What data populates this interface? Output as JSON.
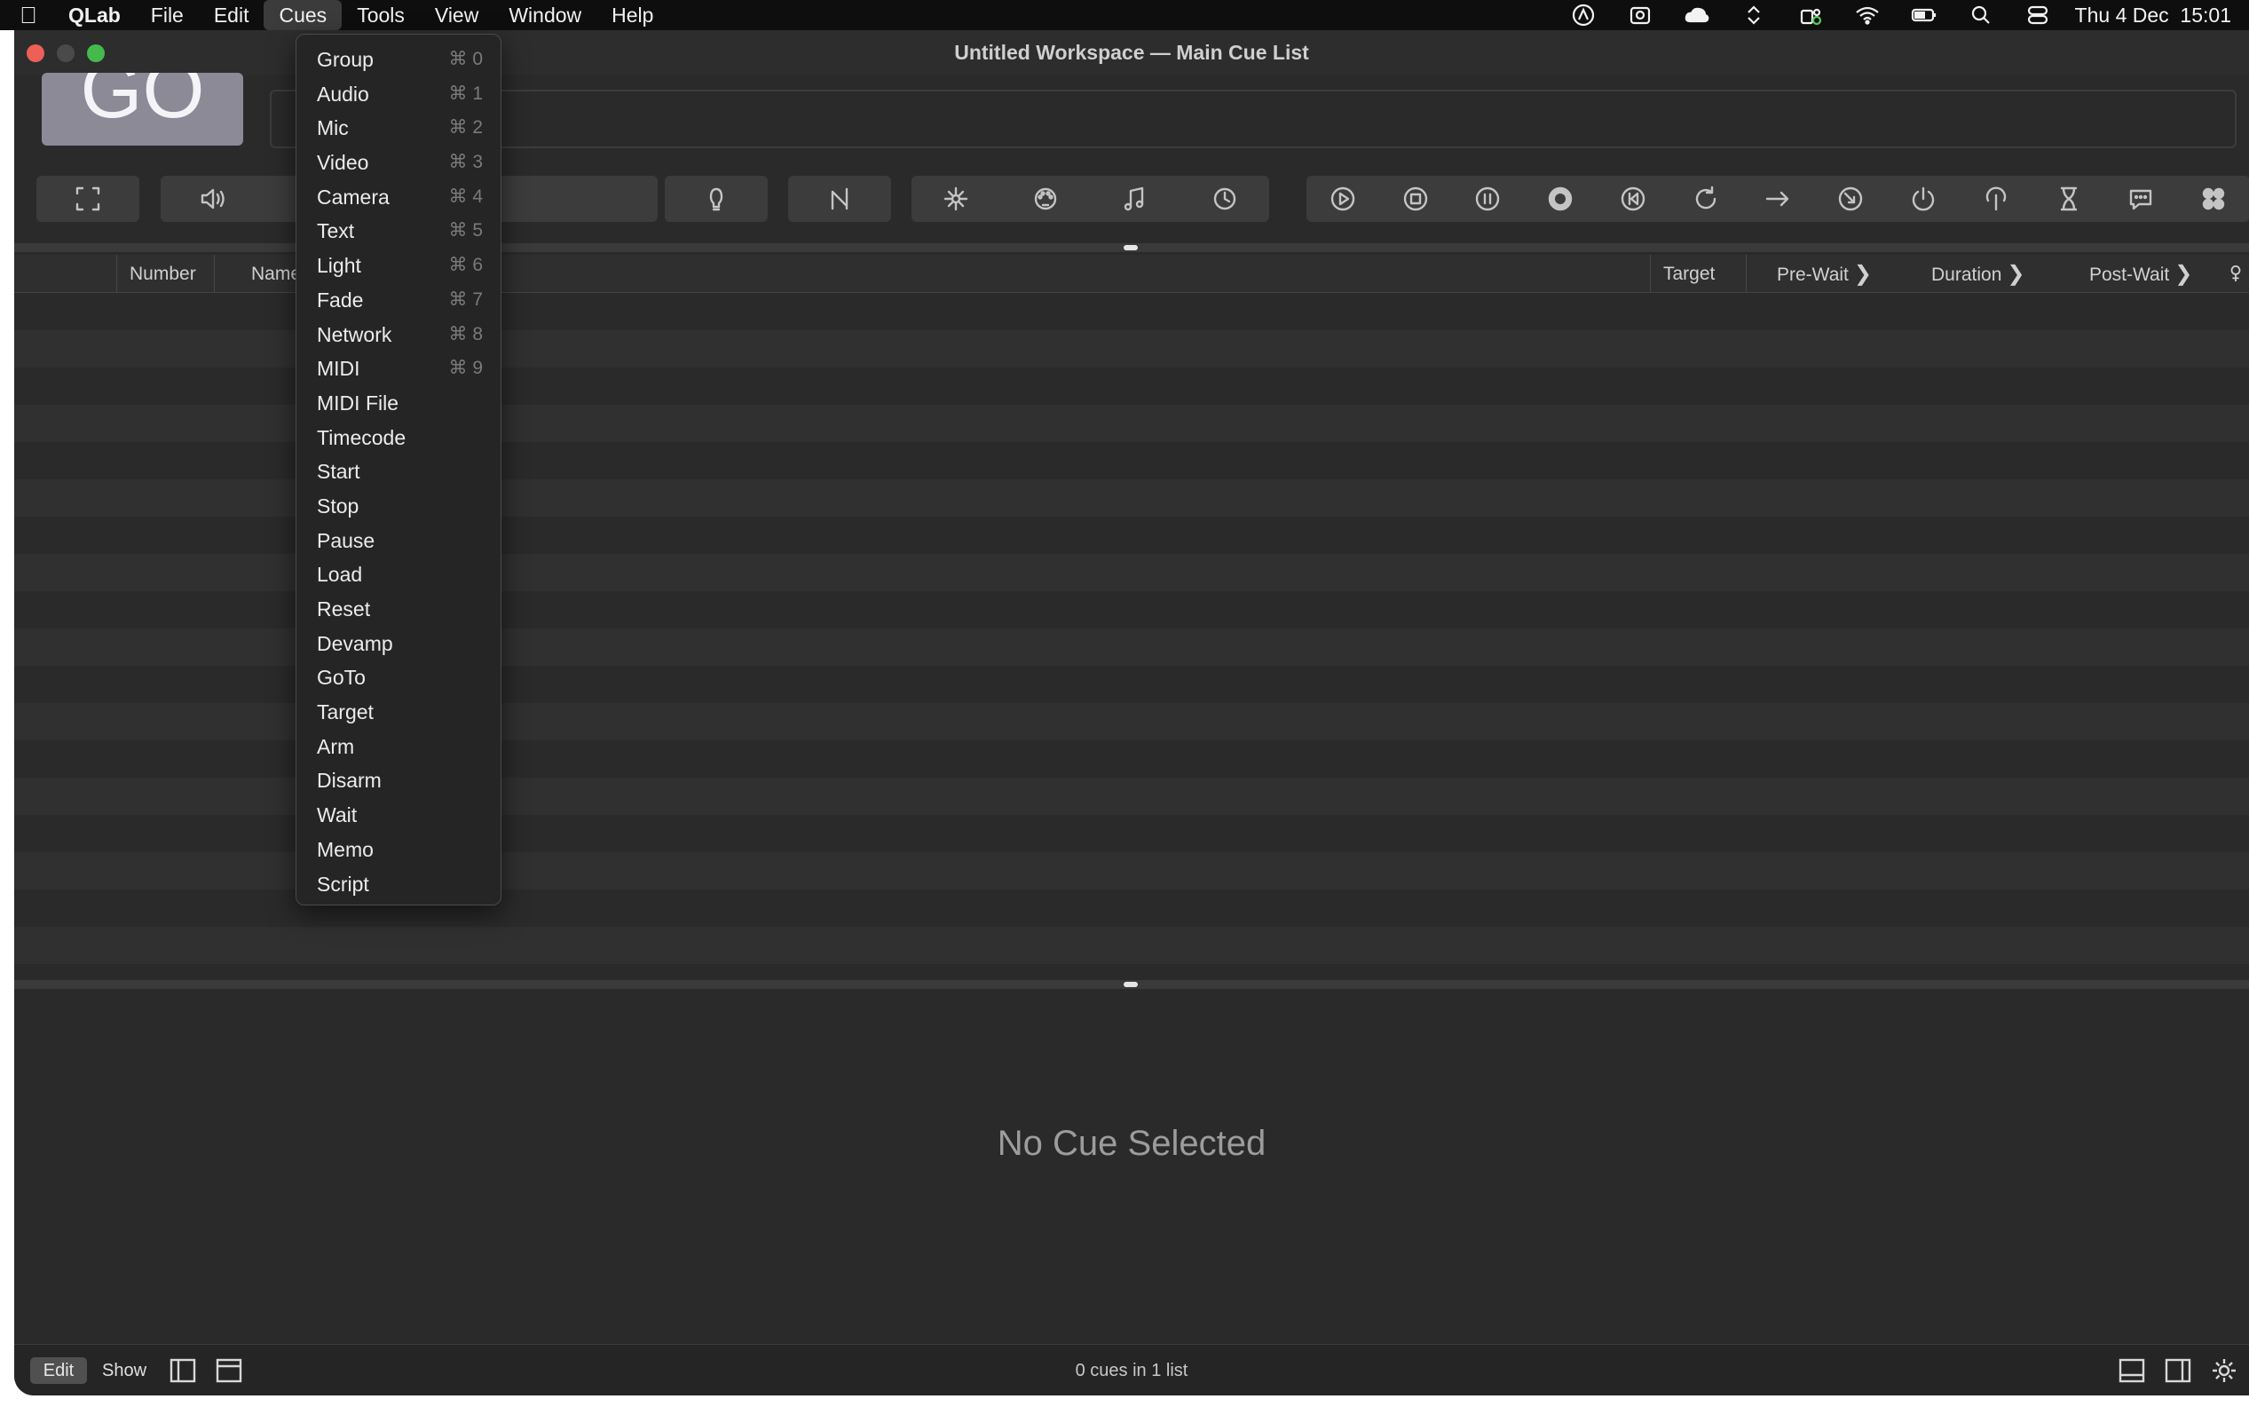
{
  "menubar": {
    "app_name": "QLab",
    "menus": [
      "File",
      "Edit",
      "Cues",
      "Tools",
      "View",
      "Window",
      "Help"
    ],
    "active_menu": "Cues",
    "clock": "Thu 4 Dec  15:01"
  },
  "window": {
    "title": "Untitled Workspace — Main Cue List",
    "go_label": "GO"
  },
  "columns": {
    "number": "Number",
    "name": "Name",
    "target": "Target",
    "pre_wait": "Pre-Wait",
    "duration": "Duration",
    "post_wait": "Post-Wait"
  },
  "inspector": {
    "empty_message": "No Cue Selected"
  },
  "footer": {
    "edit_label": "Edit",
    "show_label": "Show",
    "cue_count": "0 cues in 1 list"
  },
  "cues_menu": [
    {
      "label": "Group",
      "shortcut": "⌘ 0"
    },
    {
      "label": "Audio",
      "shortcut": "⌘ 1"
    },
    {
      "label": "Mic",
      "shortcut": "⌘ 2"
    },
    {
      "label": "Video",
      "shortcut": "⌘ 3"
    },
    {
      "label": "Camera",
      "shortcut": "⌘ 4"
    },
    {
      "label": "Text",
      "shortcut": "⌘ 5"
    },
    {
      "label": "Light",
      "shortcut": "⌘ 6"
    },
    {
      "label": "Fade",
      "shortcut": "⌘ 7"
    },
    {
      "label": "Network",
      "shortcut": "⌘ 8"
    },
    {
      "label": "MIDI",
      "shortcut": "⌘ 9"
    },
    {
      "label": "MIDI File",
      "shortcut": ""
    },
    {
      "label": "Timecode",
      "shortcut": ""
    },
    {
      "label": "Start",
      "shortcut": ""
    },
    {
      "label": "Stop",
      "shortcut": ""
    },
    {
      "label": "Pause",
      "shortcut": ""
    },
    {
      "label": "Load",
      "shortcut": ""
    },
    {
      "label": "Reset",
      "shortcut": ""
    },
    {
      "label": "Devamp",
      "shortcut": ""
    },
    {
      "label": "GoTo",
      "shortcut": ""
    },
    {
      "label": "Target",
      "shortcut": ""
    },
    {
      "label": "Arm",
      "shortcut": ""
    },
    {
      "label": "Disarm",
      "shortcut": ""
    },
    {
      "label": "Wait",
      "shortcut": ""
    },
    {
      "label": "Memo",
      "shortcut": ""
    },
    {
      "label": "Script",
      "shortcut": ""
    }
  ],
  "toolbar_icons": [
    "group-cue-icon",
    "audio-cue-icon",
    "text-cue-icon",
    "light-cue-icon",
    "fade-cue-icon",
    "network-cue-icon",
    "midi-cue-icon",
    "midi-file-cue-icon",
    "timecode-cue-icon",
    "start-cue-icon",
    "stop-cue-icon",
    "pause-cue-icon",
    "load-cue-icon",
    "reset-cue-icon",
    "devamp-cue-icon",
    "goto-cue-icon",
    "target-cue-icon",
    "arm-cue-icon",
    "disarm-cue-icon",
    "wait-cue-icon",
    "memo-cue-icon",
    "script-cue-icon"
  ],
  "colors": {
    "window_bg": "#2a2a2a",
    "go_button": "#8c8a97",
    "close": "#ed5f57",
    "zoom": "#46b94c"
  }
}
